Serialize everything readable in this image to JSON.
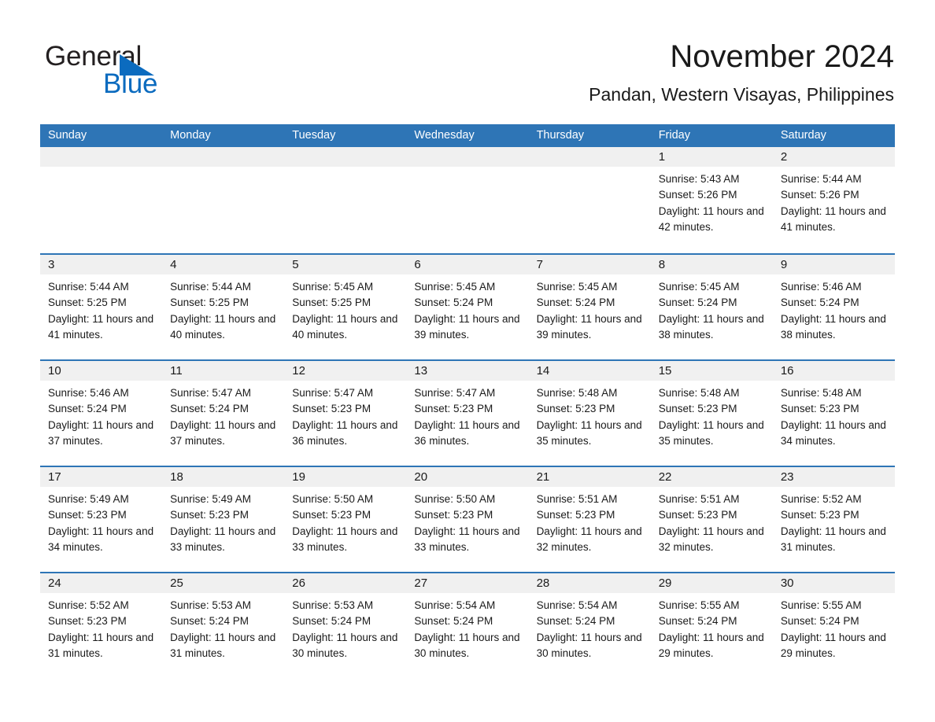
{
  "brand": {
    "name_dark": "General",
    "name_blue": "Blue",
    "triangle_color": "#0b6bbf",
    "accent_color": "#2e75b6"
  },
  "header": {
    "title": "November 2024",
    "subtitle": "Pandan, Western Visayas, Philippines"
  },
  "calendar": {
    "weekdays": [
      "Sunday",
      "Monday",
      "Tuesday",
      "Wednesday",
      "Thursday",
      "Friday",
      "Saturday"
    ],
    "header_bg": "#2e75b6",
    "day_band_bg": "#f0f0f0",
    "row_divider": "#2e75b6",
    "weeks": [
      [
        {
          "day": "",
          "lines": []
        },
        {
          "day": "",
          "lines": []
        },
        {
          "day": "",
          "lines": []
        },
        {
          "day": "",
          "lines": []
        },
        {
          "day": "",
          "lines": []
        },
        {
          "day": "1",
          "lines": [
            "Sunrise: 5:43 AM",
            "Sunset: 5:26 PM",
            "Daylight: 11 hours and 42 minutes."
          ]
        },
        {
          "day": "2",
          "lines": [
            "Sunrise: 5:44 AM",
            "Sunset: 5:26 PM",
            "Daylight: 11 hours and 41 minutes."
          ]
        }
      ],
      [
        {
          "day": "3",
          "lines": [
            "Sunrise: 5:44 AM",
            "Sunset: 5:25 PM",
            "Daylight: 11 hours and 41 minutes."
          ]
        },
        {
          "day": "4",
          "lines": [
            "Sunrise: 5:44 AM",
            "Sunset: 5:25 PM",
            "Daylight: 11 hours and 40 minutes."
          ]
        },
        {
          "day": "5",
          "lines": [
            "Sunrise: 5:45 AM",
            "Sunset: 5:25 PM",
            "Daylight: 11 hours and 40 minutes."
          ]
        },
        {
          "day": "6",
          "lines": [
            "Sunrise: 5:45 AM",
            "Sunset: 5:24 PM",
            "Daylight: 11 hours and 39 minutes."
          ]
        },
        {
          "day": "7",
          "lines": [
            "Sunrise: 5:45 AM",
            "Sunset: 5:24 PM",
            "Daylight: 11 hours and 39 minutes."
          ]
        },
        {
          "day": "8",
          "lines": [
            "Sunrise: 5:45 AM",
            "Sunset: 5:24 PM",
            "Daylight: 11 hours and 38 minutes."
          ]
        },
        {
          "day": "9",
          "lines": [
            "Sunrise: 5:46 AM",
            "Sunset: 5:24 PM",
            "Daylight: 11 hours and 38 minutes."
          ]
        }
      ],
      [
        {
          "day": "10",
          "lines": [
            "Sunrise: 5:46 AM",
            "Sunset: 5:24 PM",
            "Daylight: 11 hours and 37 minutes."
          ]
        },
        {
          "day": "11",
          "lines": [
            "Sunrise: 5:47 AM",
            "Sunset: 5:24 PM",
            "Daylight: 11 hours and 37 minutes."
          ]
        },
        {
          "day": "12",
          "lines": [
            "Sunrise: 5:47 AM",
            "Sunset: 5:23 PM",
            "Daylight: 11 hours and 36 minutes."
          ]
        },
        {
          "day": "13",
          "lines": [
            "Sunrise: 5:47 AM",
            "Sunset: 5:23 PM",
            "Daylight: 11 hours and 36 minutes."
          ]
        },
        {
          "day": "14",
          "lines": [
            "Sunrise: 5:48 AM",
            "Sunset: 5:23 PM",
            "Daylight: 11 hours and 35 minutes."
          ]
        },
        {
          "day": "15",
          "lines": [
            "Sunrise: 5:48 AM",
            "Sunset: 5:23 PM",
            "Daylight: 11 hours and 35 minutes."
          ]
        },
        {
          "day": "16",
          "lines": [
            "Sunrise: 5:48 AM",
            "Sunset: 5:23 PM",
            "Daylight: 11 hours and 34 minutes."
          ]
        }
      ],
      [
        {
          "day": "17",
          "lines": [
            "Sunrise: 5:49 AM",
            "Sunset: 5:23 PM",
            "Daylight: 11 hours and 34 minutes."
          ]
        },
        {
          "day": "18",
          "lines": [
            "Sunrise: 5:49 AM",
            "Sunset: 5:23 PM",
            "Daylight: 11 hours and 33 minutes."
          ]
        },
        {
          "day": "19",
          "lines": [
            "Sunrise: 5:50 AM",
            "Sunset: 5:23 PM",
            "Daylight: 11 hours and 33 minutes."
          ]
        },
        {
          "day": "20",
          "lines": [
            "Sunrise: 5:50 AM",
            "Sunset: 5:23 PM",
            "Daylight: 11 hours and 33 minutes."
          ]
        },
        {
          "day": "21",
          "lines": [
            "Sunrise: 5:51 AM",
            "Sunset: 5:23 PM",
            "Daylight: 11 hours and 32 minutes."
          ]
        },
        {
          "day": "22",
          "lines": [
            "Sunrise: 5:51 AM",
            "Sunset: 5:23 PM",
            "Daylight: 11 hours and 32 minutes."
          ]
        },
        {
          "day": "23",
          "lines": [
            "Sunrise: 5:52 AM",
            "Sunset: 5:23 PM",
            "Daylight: 11 hours and 31 minutes."
          ]
        }
      ],
      [
        {
          "day": "24",
          "lines": [
            "Sunrise: 5:52 AM",
            "Sunset: 5:23 PM",
            "Daylight: 11 hours and 31 minutes."
          ]
        },
        {
          "day": "25",
          "lines": [
            "Sunrise: 5:53 AM",
            "Sunset: 5:24 PM",
            "Daylight: 11 hours and 31 minutes."
          ]
        },
        {
          "day": "26",
          "lines": [
            "Sunrise: 5:53 AM",
            "Sunset: 5:24 PM",
            "Daylight: 11 hours and 30 minutes."
          ]
        },
        {
          "day": "27",
          "lines": [
            "Sunrise: 5:54 AM",
            "Sunset: 5:24 PM",
            "Daylight: 11 hours and 30 minutes."
          ]
        },
        {
          "day": "28",
          "lines": [
            "Sunrise: 5:54 AM",
            "Sunset: 5:24 PM",
            "Daylight: 11 hours and 30 minutes."
          ]
        },
        {
          "day": "29",
          "lines": [
            "Sunrise: 5:55 AM",
            "Sunset: 5:24 PM",
            "Daylight: 11 hours and 29 minutes."
          ]
        },
        {
          "day": "30",
          "lines": [
            "Sunrise: 5:55 AM",
            "Sunset: 5:24 PM",
            "Daylight: 11 hours and 29 minutes."
          ]
        }
      ]
    ]
  }
}
